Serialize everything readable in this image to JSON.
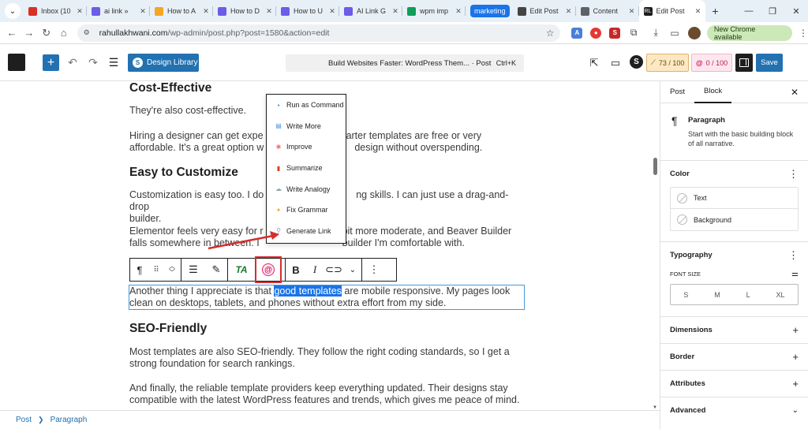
{
  "browser": {
    "tabs": [
      {
        "label": "Inbox (10",
        "fav_color": "#d93025"
      },
      {
        "label": "ai link »",
        "fav_color": "#6c5ce7"
      },
      {
        "label": "How to A",
        "fav_color": "#f5a623"
      },
      {
        "label": "How to D",
        "fav_color": "#6c5ce7"
      },
      {
        "label": "How to U",
        "fav_color": "#6c5ce7"
      },
      {
        "label": "AI Link G",
        "fav_color": "#6c5ce7"
      },
      {
        "label": "wpm imp",
        "fav_color": "#0f9d58"
      }
    ],
    "tab_group_label": "marketing",
    "tabs_after": [
      {
        "label": "Edit Post",
        "fav_color": "#444444"
      },
      {
        "label": "Content",
        "fav_color": "#5f6368"
      }
    ],
    "active_tab": {
      "label": "Edit Post",
      "fav_color": "#1e1e1e"
    },
    "url_domain": "rahullakhwani.com",
    "url_path": "/wp-admin/post.php?post=1580&action=edit",
    "new_chrome_label": "New Chrome available"
  },
  "wp_header": {
    "design_library_label": "Design Library",
    "command_title": "Build Websites Faster: WordPress Them... · Post",
    "command_shortcut": "Ctrl+K",
    "seo_score": "73 / 100",
    "ai_score": "0 / 100",
    "save_label": "Save"
  },
  "content": {
    "h_cost": "Cost-Effective",
    "p_cost1": "They're also cost-effective.",
    "p_cost2a": "Hiring a designer can get expe",
    "p_cost2b": "arter templates are free or very",
    "p_cost2c": "affordable. It's a great option w",
    "p_cost2d": "design without overspending.",
    "h_custom": "Easy to Customize",
    "p_custom1a": "Customization is easy too. I do",
    "p_custom1b": "ng skills. I can just use a drag-and-drop",
    "p_custom1c": "builder.",
    "p_custom2a": "Elementor feels very easy for r",
    "p_custom2b": "bit more moderate, and Beaver Builder",
    "p_custom2c": "falls somewhere in between. I",
    "p_custom2d": "builder I'm comfortable with.",
    "p_sel_before": "Another thing I appreciate is that ",
    "p_sel_highlight": "good templates",
    "p_sel_after": " are mobile responsive. My pages look clean on desktops, tablets, and phones without extra effort from my side.",
    "h_seo": "SEO-Friendly",
    "p_seo1": "Most templates are also SEO-friendly. They follow the right coding standards, so I get a strong foundation for search rankings.",
    "p_seo2": "And finally, the reliable template providers keep everything updated. Their designs stay compatible with the latest WordPress features and trends, which gives me peace of mind."
  },
  "ai_menu": {
    "items": [
      {
        "label": "Run as Command",
        "icon": "square-icon",
        "color": "#4a90d9"
      },
      {
        "label": "Write More",
        "icon": "book-icon",
        "color": "#4a90d9"
      },
      {
        "label": "Improve",
        "icon": "sparkle-icon",
        "color": "#e57373"
      },
      {
        "label": "Summarize",
        "icon": "book-red-icon",
        "color": "#d84315"
      },
      {
        "label": "Write Analogy",
        "icon": "cloud-icon",
        "color": "#90a4ae"
      },
      {
        "label": "Fix Grammar",
        "icon": "star-icon",
        "color": "#f5a623"
      },
      {
        "label": "Generate Link",
        "icon": "link-icon",
        "color": "#9e9e9e"
      }
    ]
  },
  "toolbar": {
    "ta_label": "TA"
  },
  "footer": {
    "crumb1": "Post",
    "crumb2": "Paragraph"
  },
  "sidebar": {
    "tab_post": "Post",
    "tab_block": "Block",
    "block_name": "Paragraph",
    "block_desc": "Start with the basic building block of all narrative.",
    "color_title": "Color",
    "color_text": "Text",
    "color_background": "Background",
    "typography_title": "Typography",
    "font_size_label": "FONT SIZE",
    "sizes": [
      "S",
      "M",
      "L",
      "XL"
    ],
    "dimensions_title": "Dimensions",
    "border_title": "Border",
    "attributes_title": "Attributes",
    "advanced_title": "Advanced"
  }
}
